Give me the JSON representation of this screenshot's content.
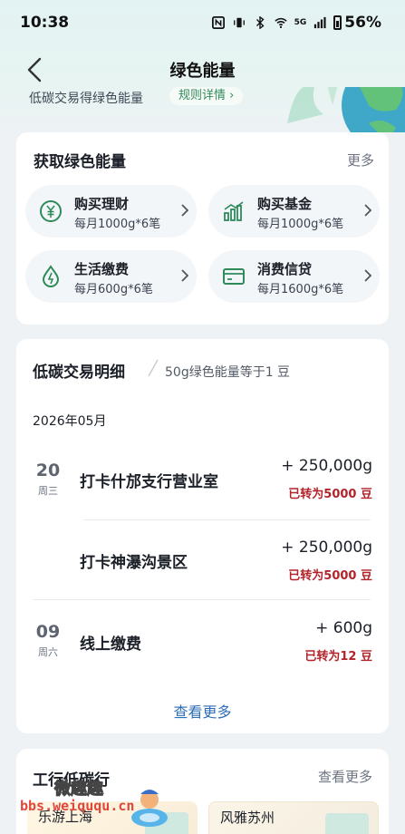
{
  "status_bar": {
    "time": "10:38",
    "network": "5G",
    "battery": "56%"
  },
  "nav": {
    "title": "绿色能量"
  },
  "banner": {
    "text": "低碳交易得绿色能量",
    "rules_button": "规则详情 ›"
  },
  "gain_card": {
    "title": "获取绿色能量",
    "more": "更多",
    "items": [
      {
        "title": "购买理财",
        "subtitle": "每月1000g*6笔",
        "icon": "yuan-coin-icon"
      },
      {
        "title": "购买基金",
        "subtitle": "每月1000g*6笔",
        "icon": "bar-chart-icon"
      },
      {
        "title": "生活缴费",
        "subtitle": "每月600g*6笔",
        "icon": "drop-icon"
      },
      {
        "title": "消费信贷",
        "subtitle": "每月1600g*6笔",
        "icon": "credit-card-icon"
      }
    ]
  },
  "detail_card": {
    "title": "低碳交易明细",
    "subtitle": "50g绿色能量等于1 豆",
    "month": "2026年05月",
    "transactions": [
      {
        "day": "20",
        "weekday": "周三",
        "name": "打卡什邡支行营业室",
        "amount": "+ 250,000g",
        "converted": "已转为5000 豆"
      },
      {
        "day": "",
        "weekday": "",
        "name": "打卡神瀑沟景区",
        "amount": "+ 250,000g",
        "converted": "已转为5000 豆"
      },
      {
        "day": "09",
        "weekday": "周六",
        "name": "线上缴费",
        "amount": "+ 600g",
        "converted": "已转为12 豆"
      }
    ],
    "see_more": "查看更多"
  },
  "bottom_card": {
    "title": "工行低碳行",
    "more": "查看更多",
    "cards": [
      {
        "label": "乐游上海"
      },
      {
        "label": "风雅苏州"
      }
    ]
  },
  "watermark": {
    "line1": "微趣趣",
    "line2": "bbs.weiququ.cn"
  },
  "colors": {
    "accent_green": "#2f8a5a",
    "conversion_red": "#b2242a",
    "link_blue": "#2f6fb7"
  }
}
